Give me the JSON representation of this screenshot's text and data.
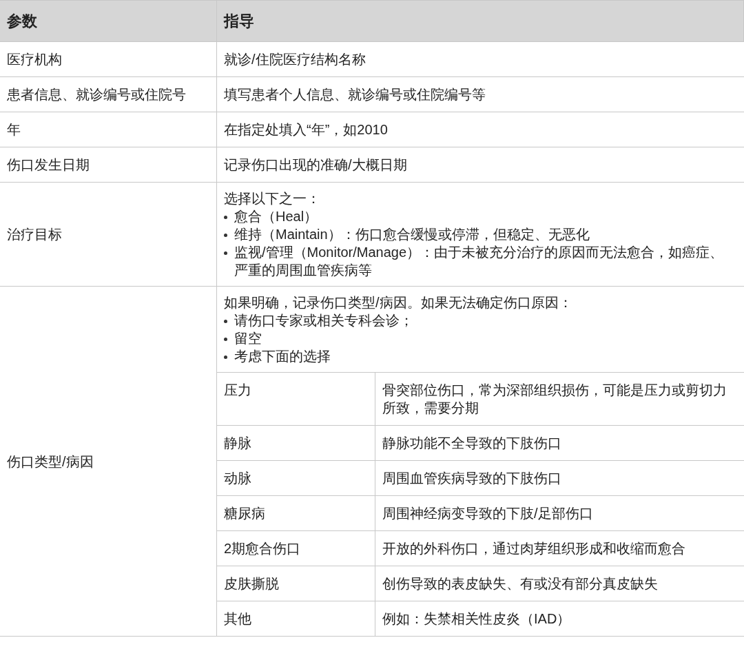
{
  "table": {
    "columns": [
      "参数",
      "指导"
    ],
    "rows": [
      {
        "parameter": "医疗机构",
        "guidance": {
          "intro": "就诊/住院医疗结构名称"
        }
      },
      {
        "parameter": "患者信息、就诊编号或住院号",
        "guidance": {
          "intro": "填写患者个人信息、就诊编号或住院编号等"
        }
      },
      {
        "parameter": "年",
        "guidance": {
          "intro": "在指定处填入“年”，如2010"
        }
      },
      {
        "parameter": "伤口发生日期",
        "guidance": {
          "intro": "记录伤口出现的准确/大概日期"
        }
      },
      {
        "parameter": "治疗目标",
        "guidance": {
          "intro": "选择以下之一：",
          "items": [
            "愈合（Heal）",
            "维持（Maintain）：伤口愈合缓慢或停滞，但稳定、无恶化",
            "监视/管理（Monitor/Manage）：由于未被充分治疗的原因而无法愈合，如癌症、严重的周围血管疾病等"
          ]
        }
      },
      {
        "parameter": "伤口类型/病因",
        "guidance": {
          "intro": "如果明确，记录伤口类型/病因。如果无法确定伤口原因：",
          "items": [
            "请伤口专家或相关专科会诊；",
            "留空",
            "考虑下面的选择"
          ],
          "subrows": [
            {
              "name": "压力",
              "description": "骨突部位伤口，常为深部组织损伤，可能是压力或剪切力所致，需要分期"
            },
            {
              "name": "静脉",
              "description": "静脉功能不全导致的下肢伤口"
            },
            {
              "name": "动脉",
              "description": "周围血管疾病导致的下肢伤口"
            },
            {
              "name": "糖尿病",
              "description": "周围神经病变导致的下肢/足部伤口"
            },
            {
              "name": "2期愈合伤口",
              "description": "开放的外科伤口，通过肉芽组织形成和收缩而愈合"
            },
            {
              "name": "皮肤撕脱",
              "description": "创伤导致的表皮缺失、有或没有部分真皮缺失"
            },
            {
              "name": "其他",
              "description": "例如：失禁相关性皮炎（IAD）"
            }
          ]
        }
      }
    ]
  }
}
